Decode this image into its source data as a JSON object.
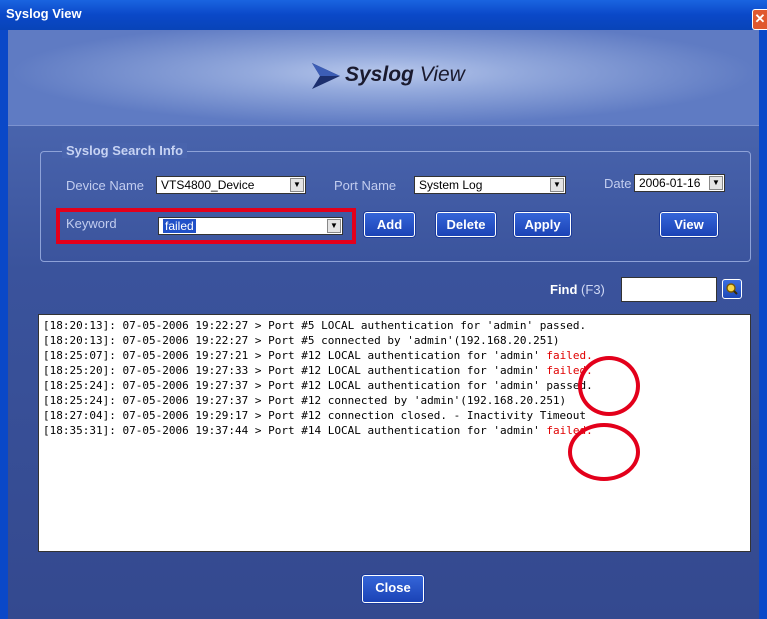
{
  "window": {
    "title": "Syslog View",
    "close_symbol": "✕"
  },
  "header": {
    "title_bold": "Syslog",
    "title_rest": " View"
  },
  "search": {
    "group_title": "Syslog Search Info",
    "device_label": "Device Name",
    "device_value": "VTS4800_Device",
    "port_label": "Port Name",
    "port_value": "System Log",
    "date_label": "Date",
    "date_value": "2006-01-16",
    "keyword_label": "Keyword",
    "keyword_value": "failed",
    "add_label": "Add",
    "delete_label": "Delete",
    "apply_label": "Apply",
    "view_label": "View"
  },
  "find": {
    "label": "Find",
    "shortcut": " (F3)"
  },
  "log": [
    {
      "text": "[18:20:13]: 07-05-2006 19:22:27 > Port #5 LOCAL authentication for 'admin' ",
      "result": "passed.",
      "failed": false
    },
    {
      "text": "[18:20:13]: 07-05-2006 19:22:27 > Port #5 connected by 'admin'(192.168.20.251)",
      "result": "",
      "failed": false
    },
    {
      "text": "[18:25:07]: 07-05-2006 19:27:21 > Port #12 LOCAL authentication for 'admin' ",
      "result": "failed.",
      "failed": true
    },
    {
      "text": "[18:25:20]: 07-05-2006 19:27:33 > Port #12 LOCAL authentication for 'admin' ",
      "result": "failed.",
      "failed": true
    },
    {
      "text": "[18:25:24]: 07-05-2006 19:27:37 > Port #12 LOCAL authentication for 'admin' ",
      "result": "passed.",
      "failed": false
    },
    {
      "text": "[18:25:24]: 07-05-2006 19:27:37 > Port #12 connected by 'admin'(192.168.20.251)",
      "result": "",
      "failed": false
    },
    {
      "text": "[18:27:04]: 07-05-2006 19:29:17 > Port #12 connection closed. - Inactivity Timeout",
      "result": "",
      "failed": false
    },
    {
      "text": "[18:35:31]: 07-05-2006 19:37:44 > Port #14 LOCAL authentication for 'admin' ",
      "result": "failed.",
      "failed": true
    }
  ],
  "footer": {
    "close_label": "Close"
  },
  "colors": {
    "accent": "#e3001b",
    "button": "#1b43b6",
    "titlebar": "#0a48c8"
  }
}
